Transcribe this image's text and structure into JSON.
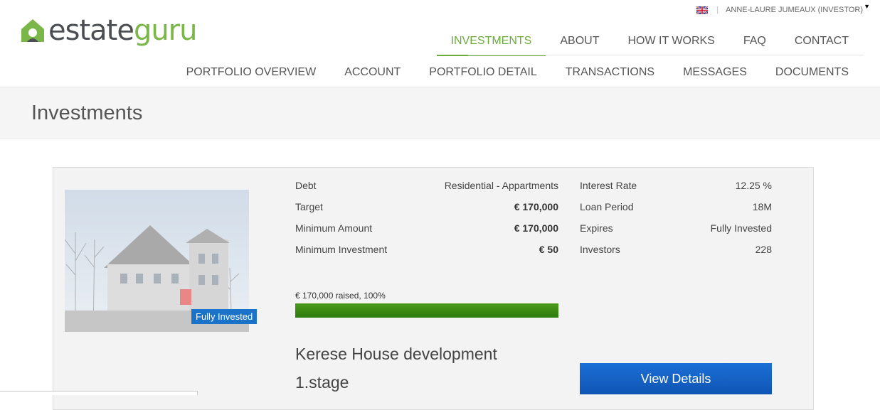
{
  "brand": {
    "name_part1": "estate",
    "name_part2": "guru",
    "primary": "#4b4f54",
    "accent": "#7ab648"
  },
  "user_bar": {
    "flag_icon": "uk-flag-icon",
    "user_name": "ANNE-LAURE JUMEAUX (INVESTOR)"
  },
  "main_nav": [
    {
      "label": "INVESTMENTS",
      "active": true
    },
    {
      "label": "ABOUT"
    },
    {
      "label": "HOW IT WORKS"
    },
    {
      "label": "FAQ"
    },
    {
      "label": "CONTACT"
    }
  ],
  "sub_nav": [
    {
      "label": "PORTFOLIO OVERVIEW"
    },
    {
      "label": "ACCOUNT"
    },
    {
      "label": "PORTFOLIO DETAIL"
    },
    {
      "label": "TRANSACTIONS"
    },
    {
      "label": "MESSAGES"
    },
    {
      "label": "DOCUMENTS"
    }
  ],
  "page": {
    "title": "Investments"
  },
  "investment": {
    "badge": "Fully Invested",
    "left_details": [
      {
        "label": "Debt",
        "value": "Residential - Appartments",
        "bold": false
      },
      {
        "label": "Target",
        "value": "€ 170,000",
        "bold": true
      },
      {
        "label": "Minimum Amount",
        "value": "€ 170,000",
        "bold": true
      },
      {
        "label": "Minimum Investment",
        "value": "€ 50",
        "bold": true
      }
    ],
    "right_details": [
      {
        "label": "Interest Rate",
        "value": "12.25 %"
      },
      {
        "label": "Loan Period",
        "value": "18M"
      },
      {
        "label": "Expires",
        "value": "Fully Invested"
      },
      {
        "label": "Investors",
        "value": "228"
      }
    ],
    "progress_text": "€ 170,000 raised, 100%",
    "progress_fraction": 1.0,
    "project_title": "Kerese House development 1.stage",
    "view_button": "View Details"
  }
}
